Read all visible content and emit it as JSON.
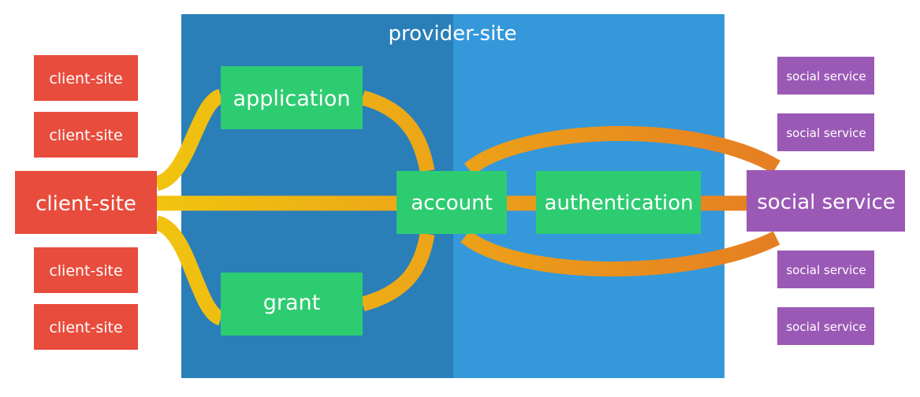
{
  "provider": {
    "title": "provider-site",
    "color_left": "#2a7fb8",
    "color_right": "#3598db"
  },
  "clients": {
    "main": "client-site",
    "small": [
      "client-site",
      "client-site",
      "client-site",
      "client-site"
    ],
    "color": "#e84c3d"
  },
  "nodes": {
    "application": "application",
    "grant": "grant",
    "account": "account",
    "authentication": "authentication",
    "color": "#2ecc71"
  },
  "social": {
    "main": "social service",
    "small": [
      "social service",
      "social service",
      "social service",
      "social service"
    ],
    "color": "#9b59b6"
  },
  "links": {
    "color_start": "#f1c40f",
    "color_end": "#e67e22"
  }
}
